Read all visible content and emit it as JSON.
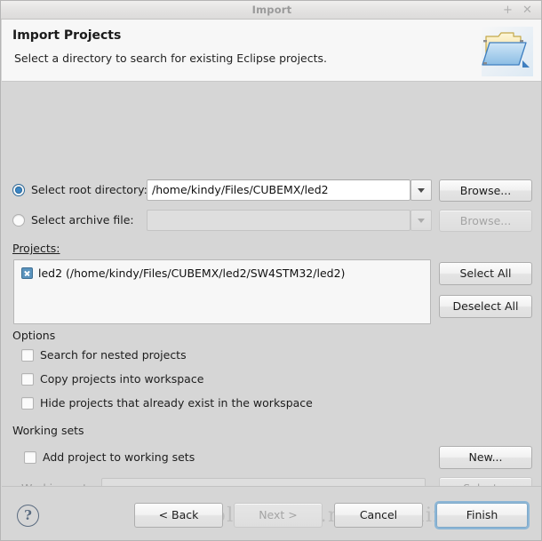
{
  "window": {
    "title": "Import",
    "maximize_icon": "plus-icon",
    "close_icon": "close-icon"
  },
  "header": {
    "title": "Import Projects",
    "subtitle": "Select a directory to search for existing Eclipse projects.",
    "icon": "open-folder-icon"
  },
  "source": {
    "root_directory": {
      "label": "Select root directory:",
      "selected": true,
      "value": "/home/kindy/Files/CUBEMX/led2",
      "placeholder": "",
      "browse_label": "Browse...",
      "browse_enabled": true,
      "dropdown_icon": "chevron-down-icon"
    },
    "archive_file": {
      "label": "Select archive file:",
      "selected": false,
      "value": "",
      "placeholder": "",
      "browse_label": "Browse...",
      "browse_enabled": false,
      "dropdown_icon": "chevron-down-icon"
    }
  },
  "projects": {
    "label": "Projects:",
    "items": [
      {
        "checked": true,
        "label": "led2 (/home/kindy/Files/CUBEMX/led2/SW4STM32/led2)"
      }
    ],
    "select_all_label": "Select All",
    "deselect_all_label": "Deselect All"
  },
  "options": {
    "title": "Options",
    "items": [
      {
        "label": "Search for nested projects",
        "checked": false
      },
      {
        "label": "Copy projects into workspace",
        "checked": false
      },
      {
        "label": "Hide projects that already exist in the workspace",
        "checked": false
      }
    ]
  },
  "working_sets": {
    "title": "Working sets",
    "add_checkbox": {
      "label": "Add project to working sets",
      "checked": false
    },
    "new_button": "New...",
    "combo_label": "Working sets:",
    "combo_value": "",
    "combo_enabled": false,
    "select_button": "Select...",
    "select_enabled": false,
    "dropdown_icon": "chevron-down-icon"
  },
  "footer": {
    "help_icon": "question-mark-icon",
    "back_label": "< Back",
    "next_label": "Next >",
    "next_enabled": false,
    "cancel_label": "Cancel",
    "finish_label": "Finish",
    "finish_is_default": true
  },
  "watermark": {
    "text": "http://blog.csdn.net/ouening"
  },
  "colors": {
    "accent": "#3b86c6",
    "check_fill": "#5a93bd",
    "focus_ring": "#8cb6d6",
    "dialog_bg": "#d6d6d6",
    "header_bg": "#f7f7f7"
  }
}
